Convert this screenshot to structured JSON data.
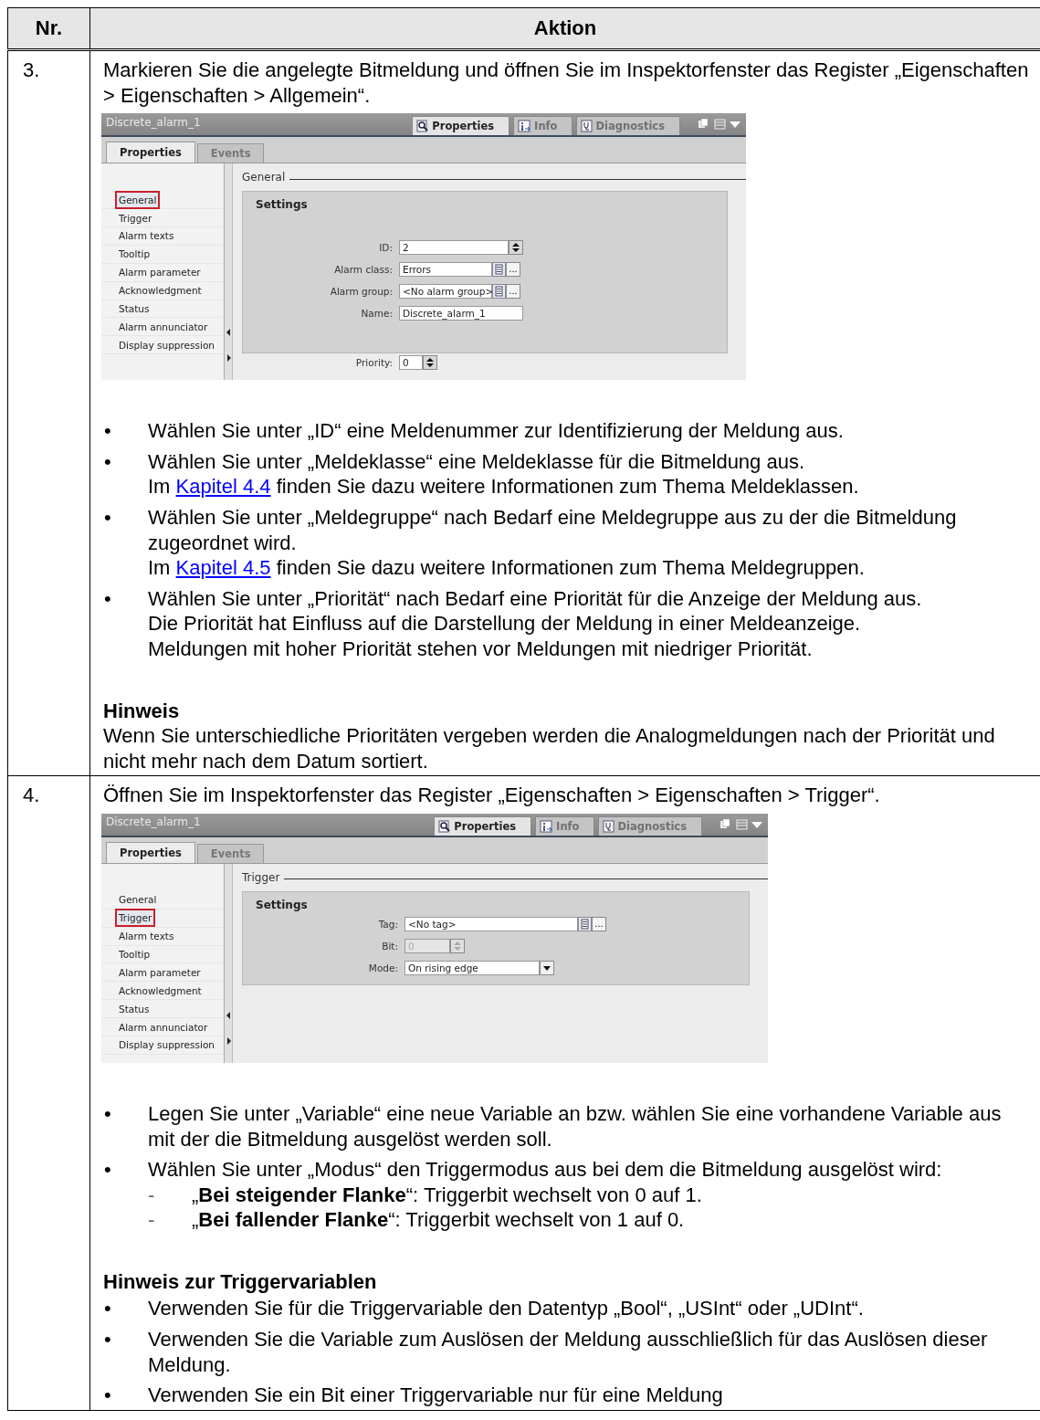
{
  "table": {
    "columns": [
      "Nr.",
      "Aktion"
    ],
    "rows": [
      {
        "number": "3.",
        "intro": "Markieren Sie die angelegte Bitmeldung und öffnen Sie im Inspektorfenster das Register „Eigenschaften > Eigenschaften > Allgemein“.",
        "screenshot": {
          "title": "Discrete_alarm_1",
          "top_tabs": [
            {
              "label": "Properties",
              "selected": true
            },
            {
              "label": "Info",
              "selected": false
            },
            {
              "label": "Diagnostics",
              "selected": false
            }
          ],
          "sub_tabs": [
            {
              "label": "Properties",
              "selected": true
            },
            {
              "label": "Events",
              "selected": false
            }
          ],
          "nav_items": [
            {
              "label": "General",
              "highlighted": true
            },
            {
              "label": "Trigger",
              "highlighted": false
            },
            {
              "label": "Alarm texts",
              "highlighted": false
            },
            {
              "label": "Tooltip",
              "highlighted": false
            },
            {
              "label": "Alarm parameter",
              "highlighted": false
            },
            {
              "label": "Acknowledgment",
              "highlighted": false
            },
            {
              "label": "Status",
              "highlighted": false
            },
            {
              "label": "Alarm annunciator",
              "highlighted": false
            },
            {
              "label": "Display suppression",
              "highlighted": false
            }
          ],
          "section_title": "General",
          "group_title": "Settings",
          "fields": [
            {
              "kind": "spin",
              "label": "ID:",
              "value": "2",
              "disabled": false
            },
            {
              "kind": "lookup",
              "label": "Alarm class:",
              "value": "Errors",
              "browse_label": "...",
              "disabled": false
            },
            {
              "kind": "lookup",
              "label": "Alarm group:",
              "value": "<No alarm group>",
              "browse_label": "...",
              "disabled": false
            },
            {
              "kind": "text",
              "label": "Name:",
              "value": "Discrete_alarm_1",
              "disabled": false
            },
            {
              "kind": "short_spin",
              "label": "Priority:",
              "value": "0",
              "disabled": false
            }
          ]
        },
        "bullets": [
          {
            "marker": "•",
            "text": "Wählen Sie unter „ID“ eine Meldenummer zur Identifizierung der Meldung aus."
          },
          {
            "marker": "•",
            "text": "Wählen Sie unter „Meldeklasse“ eine Meldeklasse für die Bitmeldung aus.",
            "link_line": {
              "before": "Im",
              "link": "Kapitel 4.4",
              "after": "finden Sie dazu weitere Informationen zum Thema Meldeklassen."
            }
          },
          {
            "marker": "•",
            "text": "Wählen Sie unter „Meldegruppe“ nach Bedarf eine Meldegruppe aus zu der die Bitmeldung zugeordnet wird.",
            "link_line": {
              "before": "Im",
              "link": "Kapitel 4.5",
              "after": "finden Sie dazu weitere Informationen zum Thema Meldegruppen."
            }
          },
          {
            "marker": "•",
            "text": "Wählen Sie unter „Priorität“ nach Bedarf eine Priorität für die Anzeige der Meldung aus.",
            "extra_lines": [
              "Die Priorität hat Einfluss auf die Darstellung der Meldung in einer Meldeanzeige.",
              "Meldungen mit hoher Priorität stehen vor Meldungen mit niedriger Priorität."
            ]
          }
        ],
        "note": {
          "title": "Hinweis",
          "text": "Wenn Sie unterschiedliche Prioritäten vergeben werden die Analogmeldungen nach der Priorität und nicht mehr nach dem Datum sortiert."
        }
      },
      {
        "number": "4.",
        "intro": "Öffnen Sie im Inspektorfenster das Register „Eigenschaften > Eigenschaften > Trigger“.",
        "screenshot": {
          "title": "Discrete_alarm_1",
          "top_tabs": [
            {
              "label": "Properties",
              "selected": true
            },
            {
              "label": "Info",
              "selected": false
            },
            {
              "label": "Diagnostics",
              "selected": false
            }
          ],
          "sub_tabs": [
            {
              "label": "Properties",
              "selected": true
            },
            {
              "label": "Events",
              "selected": false
            }
          ],
          "nav_items": [
            {
              "label": "General",
              "highlighted": false
            },
            {
              "label": "Trigger",
              "highlighted": true
            },
            {
              "label": "Alarm texts",
              "highlighted": false
            },
            {
              "label": "Tooltip",
              "highlighted": false
            },
            {
              "label": "Alarm parameter",
              "highlighted": false
            },
            {
              "label": "Acknowledgment",
              "highlighted": false
            },
            {
              "label": "Status",
              "highlighted": false
            },
            {
              "label": "Alarm annunciator",
              "highlighted": false
            },
            {
              "label": "Display suppression",
              "highlighted": false
            }
          ],
          "section_title": "Trigger",
          "group_title": "Settings",
          "fields": [
            {
              "kind": "lookup",
              "label": "Tag:",
              "value": "<No tag>",
              "browse_label": "...",
              "disabled": false
            },
            {
              "kind": "short_spin",
              "label": "Bit:",
              "value": "0",
              "disabled": true
            },
            {
              "kind": "dropdown",
              "label": "Mode:",
              "value": "On rising edge",
              "disabled": false
            }
          ]
        },
        "bullets": [
          {
            "marker": "•",
            "text": "Legen Sie unter „Variable“ eine neue Variable an bzw. wählen Sie eine vorhandene Variable aus mit der die Bitmeldung ausgelöst werden soll."
          },
          {
            "marker": "•",
            "text": "Wählen Sie unter „Modus“ den Triggermodus aus bei dem die Bitmeldung ausgelöst wird:",
            "children": [
              {
                "marker": "-",
                "text": "„**Bei steigender Flanke**“: Triggerbit wechselt von 0 auf 1."
              },
              {
                "marker": "-",
                "text": "„**Bei fallender Flanke**“: Triggerbit wechselt von 1 auf 0."
              }
            ]
          }
        ],
        "note": {
          "title": "Hinweis zur Triggervariablen",
          "bullets": [
            {
              "marker": "•",
              "text": "Verwenden Sie für die Triggervariable den Datentyp „Bool“, „USInt“ oder „UDInt“."
            },
            {
              "marker": "•",
              "text": "Verwenden Sie die Variable zum Auslösen der Meldung ausschließlich für das Auslösen dieser Meldung."
            },
            {
              "marker": "•",
              "text": "Verwenden Sie ein Bit einer Triggervariable nur für eine Meldung"
            }
          ]
        }
      }
    ]
  }
}
